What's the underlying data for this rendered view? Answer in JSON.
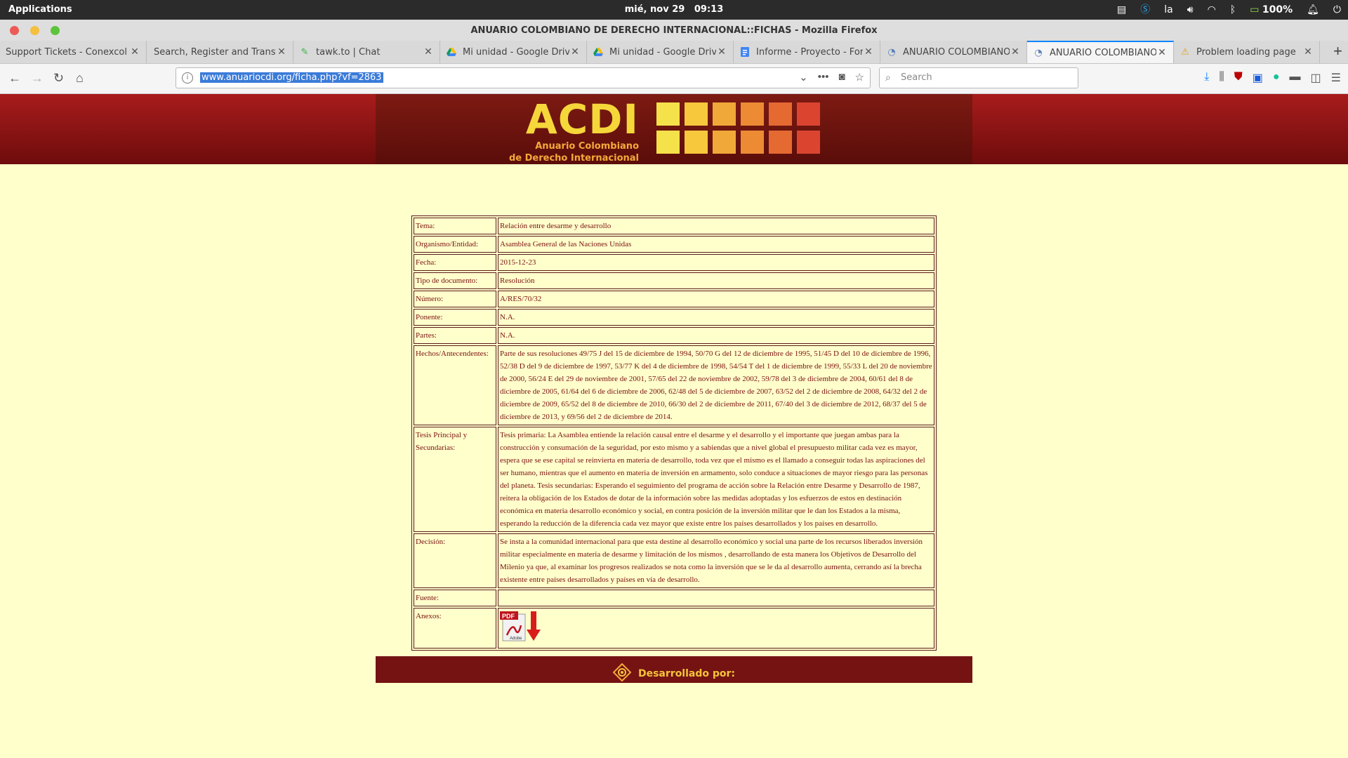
{
  "system": {
    "apps_label": "Applications",
    "date": "mié, nov 29",
    "time": "09:13",
    "lang": "la",
    "battery": "100%"
  },
  "window": {
    "title": "ANUARIO COLOMBIANO DE DERECHO INTERNACIONAL::FICHAS - Mozilla Firefox"
  },
  "tabs": [
    {
      "label": "Support Tickets - Conexcol Clo"
    },
    {
      "label": "Search, Register and Transfer"
    },
    {
      "label": "tawk.to | Chat"
    },
    {
      "label": "Mi unidad - Google Drive"
    },
    {
      "label": "Mi unidad - Google Drive"
    },
    {
      "label": "Informe - Proyecto - Formu"
    },
    {
      "label": "ANUARIO COLOMBIANO D"
    },
    {
      "label": "ANUARIO COLOMBIANO D"
    },
    {
      "label": "Problem loading page"
    }
  ],
  "nav": {
    "url": "www.anuariocdi.org/ficha.php?vf=2863",
    "search_placeholder": "Search"
  },
  "header": {
    "logo": "ACDI",
    "subtitle_1": "Anuario Colombiano",
    "subtitle_2": "de Derecho Internacional",
    "square_colors": [
      "#f5e14a",
      "#f7c83c",
      "#f0a838",
      "#ec8b34",
      "#e56a32",
      "#db4530"
    ]
  },
  "ficha": {
    "rows": [
      {
        "label": "Tema:",
        "value": "Relación entre desarme y desarrollo"
      },
      {
        "label": "Organismo/Entidad:",
        "value": "Asamblea General de las Naciones Unidas"
      },
      {
        "label": "Fecha:",
        "value": "2015-12-23"
      },
      {
        "label": "Tipo de documento:",
        "value": "Resolución"
      },
      {
        "label": "Número:",
        "value": "A/RES/70/32"
      },
      {
        "label": "Ponente:",
        "value": "N.A."
      },
      {
        "label": "Partes:",
        "value": "N.A."
      },
      {
        "label": "Hechos/Antecendentes:",
        "value": "Parte de sus resoluciones 49/75 J del 15 de diciembre de 1994, 50/70 G del 12 de diciembre de 1995, 51/45 D del 10 de diciembre de 1996, 52/38 D del 9 de diciembre de 1997, 53/77 K del 4 de diciembre de 1998, 54/54 T del 1 de diciembre de 1999, 55/33 L del 20 de noviembre de 2000, 56/24 E del 29 de noviembre de 2001, 57/65 del 22 de noviembre de 2002, 59/78 del 3 de diciembre de 2004, 60/61 del 8 de diciembre de 2005, 61/64 del 6 de diciembre de 2006, 62/48 del 5 de diciembre de 2007, 63/52 del 2 de diciembre de 2008, 64/32 del 2 de diciembre de 2009, 65/52 del 8 de diciembre de 2010, 66/30 del 2 de diciembre de 2011, 67/40 del 3 de diciembre de 2012, 68/37 del 5 de diciembre de 2013, y 69/56 del 2 de diciembre de 2014."
      },
      {
        "label": "Tesis Principal y Secundarias:",
        "value": "Tesis primaria: La Asamblea entiende la relación causal entre el desarme y el desarrollo y el importante que juegan ambas para la construcción y consumación de la seguridad, por esto mismo y a sabiendas que a nivel global el presupuesto militar cada vez es mayor, espera que se ese capital se reinvierta en materia de desarrollo, toda vez que el mismo es el llamado a conseguir todas las aspiraciones del ser humano, mientras que el aumento en materia de inversión en armamento, solo conduce a situaciones de mayor riesgo para las personas del planeta. Tesis secundarias: Esperando el seguimiento del programa de acción sobre la Relación entre Desarme y Desarrollo de 1987, reitera la obligación de los Estados de dotar de la información sobre las medidas adoptadas y los esfuerzos de estos en destinación económica en materia desarrollo económico y social, en contra posición de la inversión militar que le dan los Estados a la misma, esperando la reducción de la diferencia cada vez mayor que existe entre los países desarrollados y los países en desarrollo."
      },
      {
        "label": "Decisión:",
        "value": "Se insta a la comunidad internacional para que esta destine al desarrollo económico y social una parte de los recursos liberados inversión militar especialmente en materia de desarme y limitación de los mismos , desarrollando de esta manera los Objetivos de Desarrollo del Milenio ya que, al examinar los progresos realizados se nota como la inversión que se le da al desarrollo aumenta, cerrando así la brecha existente entre países desarrollados y países en vía de desarrollo."
      },
      {
        "label": "Fuente:",
        "value": ""
      },
      {
        "label": "Anexos:",
        "value": ""
      }
    ],
    "pdf_label": "PDF",
    "pdf_brand": "Adobe"
  },
  "footer": {
    "text": "Desarrollado por:"
  }
}
